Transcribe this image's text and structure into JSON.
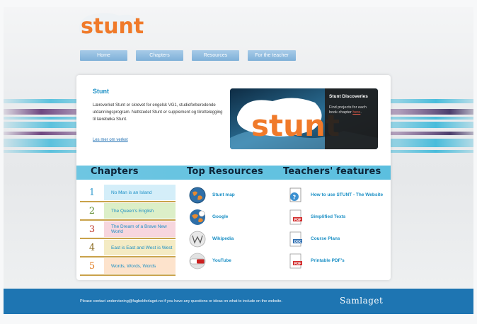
{
  "header": {
    "logo_text": "stunt",
    "tagline_line1": "",
    "tagline_line2": ""
  },
  "nav": [
    {
      "label": "Home"
    },
    {
      "label": "Chapters"
    },
    {
      "label": "Resources"
    },
    {
      "label": "For the teacher"
    }
  ],
  "intro": {
    "title": "Stunt",
    "text": "Læreverket Stunt er skrevet for engelsk VG1, studieforberedende utdanningsprogram. Nettstedet Stunt er supplement og tilrettelegging til lærebøka Stunt.",
    "link": "Les mer om verket"
  },
  "banner": {
    "logo_text": "stunt",
    "title": "Stunt Discoveries",
    "desc_prefix": "Find projects for each book chapter ",
    "desc_link": "here",
    "desc_suffix": "."
  },
  "sections": {
    "chapters_heading": "Chapters",
    "resources_heading": "Top Resources",
    "teachers_heading": "Teachers' features"
  },
  "chapters": [
    {
      "number": "1",
      "title": "No Man is an Island",
      "color": "#3a9fd0",
      "bg": "#d4eef9"
    },
    {
      "number": "2",
      "title": "The Queen's English",
      "color": "#5d8a2e",
      "bg": "#dcefc8"
    },
    {
      "number": "3",
      "title": "The Dream of a Brave New World",
      "color": "#c0392b",
      "bg": "#f7d6de"
    },
    {
      "number": "4",
      "title": "East is East and West is West",
      "color": "#8a6a1e",
      "bg": "#f4ebc4"
    },
    {
      "number": "5",
      "title": "Words, Words, Words",
      "color": "#e07a1e",
      "bg": "#fde3cc"
    }
  ],
  "resources": [
    {
      "label": "Stunt map",
      "icon": "globe-icon"
    },
    {
      "label": "Google",
      "icon": "google-globe-icon"
    },
    {
      "label": "Wikipedia",
      "icon": "wikipedia-icon"
    },
    {
      "label": "YouTube",
      "icon": "youtube-icon"
    }
  ],
  "teachers": [
    {
      "label": "How to use STUNT - The Website",
      "icon": "help-document-icon"
    },
    {
      "label": "Simplified Texts",
      "icon": "pdf-icon"
    },
    {
      "label": "Course Plans",
      "icon": "doc-icon"
    },
    {
      "label": "Printable PDF's",
      "icon": "pdf-icon"
    }
  ],
  "footer": {
    "text": "Please contact undervisning@fagbokforlaget.no if you have any questions or ideas on what to include on the website.",
    "logo": "Samlaget"
  },
  "colors": {
    "accent": "#1a8fc5",
    "footer": "#1e75b2",
    "nav": "#8ebde2",
    "stripe": "#5bbfdf",
    "logo_orange": "#f07a2a"
  }
}
